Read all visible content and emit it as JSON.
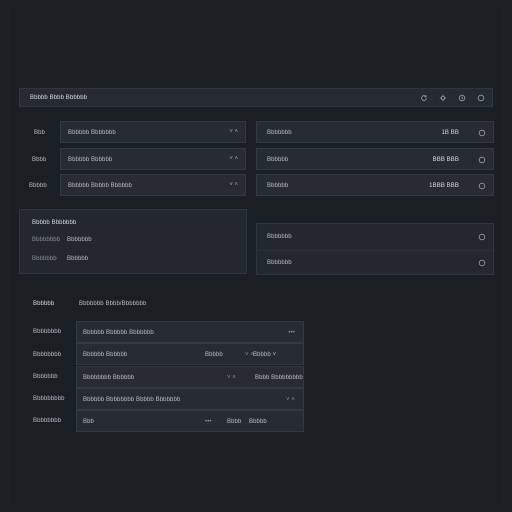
{
  "header": {
    "title": "Bbbbb Bbbb Bbbbbb",
    "icons": [
      "refresh-icon",
      "settings-icon",
      "clock-icon",
      "user-icon"
    ]
  },
  "config_rows": [
    {
      "label": "Bbb",
      "field": "Bbbbbb Bbbbbbb",
      "control": "˅ ˄"
    },
    {
      "label": "Bbbb",
      "field": "Bbbbbb Bbbbbb",
      "control": "˅ ˄"
    },
    {
      "label": "Bbbbb",
      "field": "Bbbbbb Bbbbb Bbbbbb",
      "control": "˅ ˄"
    }
  ],
  "stat_rows": [
    {
      "label": "Bbbbbbb",
      "value": "1B BB"
    },
    {
      "label": "Bbbbbb",
      "value": "BBB BBB"
    },
    {
      "label": "Bbbbbb",
      "value": "1BBB BBB"
    }
  ],
  "info_panel": {
    "title": "Bbbbb Bbbbbbb",
    "rows": [
      {
        "key": "Bbbbbbbb",
        "value": "Bbbbbbb"
      },
      {
        "key": "Bbbbbbb",
        "value": "Bbbbbb"
      }
    ]
  },
  "side_panel_rows": [
    {
      "label": "Bbbbbbb"
    },
    {
      "label": "Bbbbbbb"
    }
  ],
  "section": {
    "label": "Bbbbbb",
    "subtitle": "Bbbbbbb Bbbb/Bbbbbbb"
  },
  "table_rows": [
    {
      "label": "Bbbbbbbb",
      "cells": [
        "Bbbbbb Bbbbbb Bbbbbbb",
        "",
        "",
        "•••"
      ]
    },
    {
      "label": "Bbbbbbbb",
      "cells": [
        "Bbbbbb Bbbbbb",
        "Bbbbb",
        "˅ ˄",
        "Bbbbb ˅"
      ]
    },
    {
      "label": "Bbbbbbb",
      "cells": [
        "Bbbbbbbb Bbbbbb",
        "",
        "˅ ˄",
        "Bbbb Bbbbbbbbb"
      ]
    },
    {
      "label": "Bbbbbbbbb",
      "cells": [
        "Bbbbbb Bbbbbbbb Bbbbb Bbbbbbb",
        "",
        "",
        "˅ ˄"
      ]
    },
    {
      "label": "Bbbbbbbb",
      "cells": [
        "Bbb",
        "•••",
        "Bbbb",
        "Bbbbb"
      ]
    }
  ],
  "colors": {
    "background": "#1c2126",
    "panel": "#262c32",
    "border": "#323940",
    "text": "#b8bdc2"
  }
}
